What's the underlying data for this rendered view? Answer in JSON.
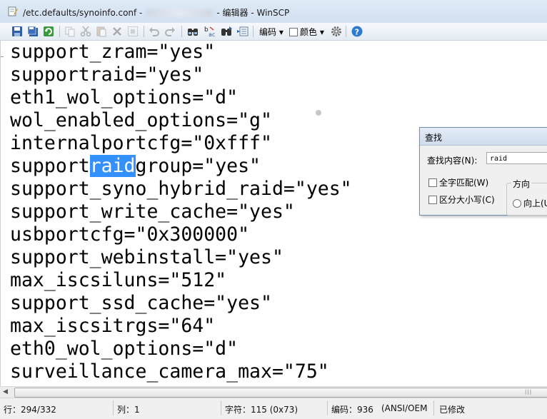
{
  "window": {
    "title_prefix": "/etc.defaults/synoinfo.conf -",
    "title_suffix": "- 编辑器 - WinSCP"
  },
  "toolbar": {
    "encoding_label": "编码",
    "color_label": "颜色"
  },
  "editor": {
    "lines": [
      "support_zram=\"yes\"",
      "supportraid=\"yes\"",
      "eth1_wol_options=\"d\"",
      "wol_enabled_options=\"g\"",
      "internalportcfg=\"0xfff\"",
      "support",
      "support_syno_hybrid_raid=\"yes\"",
      "support_write_cache=\"yes\"",
      "usbportcfg=\"0x300000\"",
      "support_webinstall=\"yes\"",
      "max_iscsiluns=\"512\"",
      "support_ssd_cache=\"yes\"",
      "max_iscsitrgs=\"64\"",
      "eth0_wol_options=\"d\"",
      "surveillance_camera_max=\"75\""
    ],
    "highlight_match": "raid",
    "highlight_rest": "group=\"yes\""
  },
  "status": {
    "line": "行：294/332",
    "column": "列：1",
    "char": "字符：115 (0x73)",
    "encoding": "编码：936",
    "encoding_name": "(ANSI/OEM",
    "modified": "已修改"
  },
  "find_dialog": {
    "title": "查找",
    "find_label": "查找内容(N):",
    "find_value": "raid",
    "whole_word": "全字匹配(W)",
    "match_case": "区分大小写(C)",
    "direction_title": "方向",
    "direction_up": "向上(U)"
  }
}
